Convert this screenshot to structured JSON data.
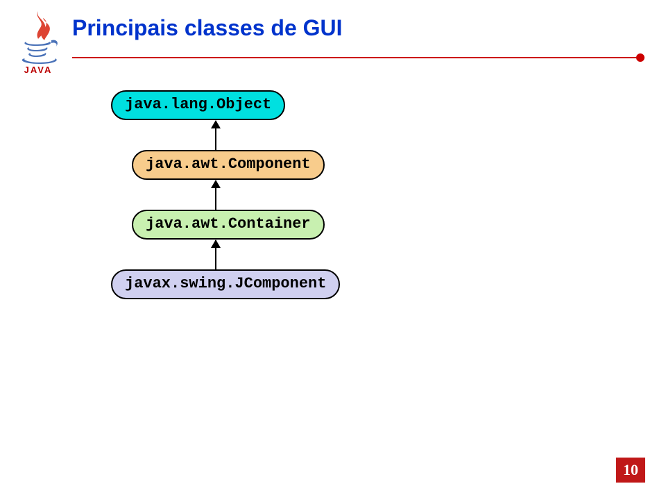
{
  "title": "Principais classes de GUI",
  "chart_data": {
    "type": "diagram",
    "hierarchy": [
      {
        "label": "java.lang.Object",
        "fill": "#00e0e0"
      },
      {
        "label": "java.awt.Component",
        "fill": "#f8cc8c"
      },
      {
        "label": "java.awt.Container",
        "fill": "#c8f0b0"
      },
      {
        "label": "javax.swing.JComponent",
        "fill": "#d0d0f0"
      }
    ],
    "edges": [
      {
        "from": "java.awt.Component",
        "to": "java.lang.Object"
      },
      {
        "from": "java.awt.Container",
        "to": "java.awt.Component"
      },
      {
        "from": "javax.swing.JComponent",
        "to": "java.awt.Container"
      }
    ],
    "title": "Principais classes de GUI"
  },
  "page_number": "10"
}
